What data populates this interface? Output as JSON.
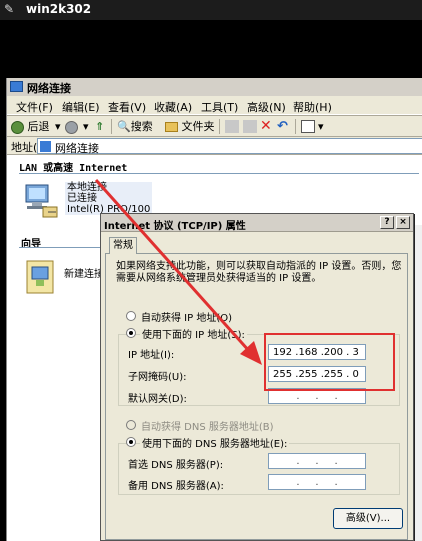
{
  "session": {
    "title": "win2k302"
  },
  "explorer": {
    "title": "网络连接",
    "menu": [
      "文件(F)",
      "编辑(E)",
      "查看(V)",
      "收藏(A)",
      "工具(T)",
      "高级(N)",
      "帮助(H)"
    ],
    "toolbar": {
      "back": "后退",
      "search": "搜索",
      "folders": "文件夹"
    },
    "address": {
      "label": "地址(D)",
      "value": "网络连接"
    },
    "group_lan": "LAN 或高速 Internet",
    "lan_item": {
      "name": "本地连接",
      "status": "已连接",
      "device": "Intel(R) PRO/100"
    },
    "group_wizard": "向导",
    "wizard_item": "新建连接"
  },
  "dialog": {
    "title": "Internet 协议 (TCP/IP) 属性",
    "help_button": "?",
    "close_button": "×",
    "tab_general": "常规",
    "description": "如果网络支持此功能，则可以获取自动指派的 IP 设置。否则，您需要从网络系统管理员处获得适当的 IP 设置。",
    "auto_ip_label": "自动获得 IP 地址(O)",
    "manual_ip_label": "使用下面的 IP 地址(S):",
    "ip_label": "IP 地址(I):",
    "ip_value": "192 .168 .200 . 3",
    "mask_label": "子网掩码(U):",
    "mask_value": "255 .255 .255 . 0",
    "gateway_label": "默认网关(D):",
    "gateway_value": "",
    "empty_dots": ".     .     .",
    "auto_dns_label": "自动获得 DNS 服务器地址(B)",
    "manual_dns_label": "使用下面的 DNS 服务器地址(E):",
    "preferred_dns_label": "首选 DNS 服务器(P):",
    "alternate_dns_label": "备用 DNS 服务器(A):",
    "advanced_button": "高级(V)...",
    "manual_ip_selected": true,
    "manual_dns_selected": true
  },
  "colors": {
    "highlight_box": "#e03030",
    "annotation_arrow": "#e03030",
    "title_gray": "#d4d0c8"
  }
}
